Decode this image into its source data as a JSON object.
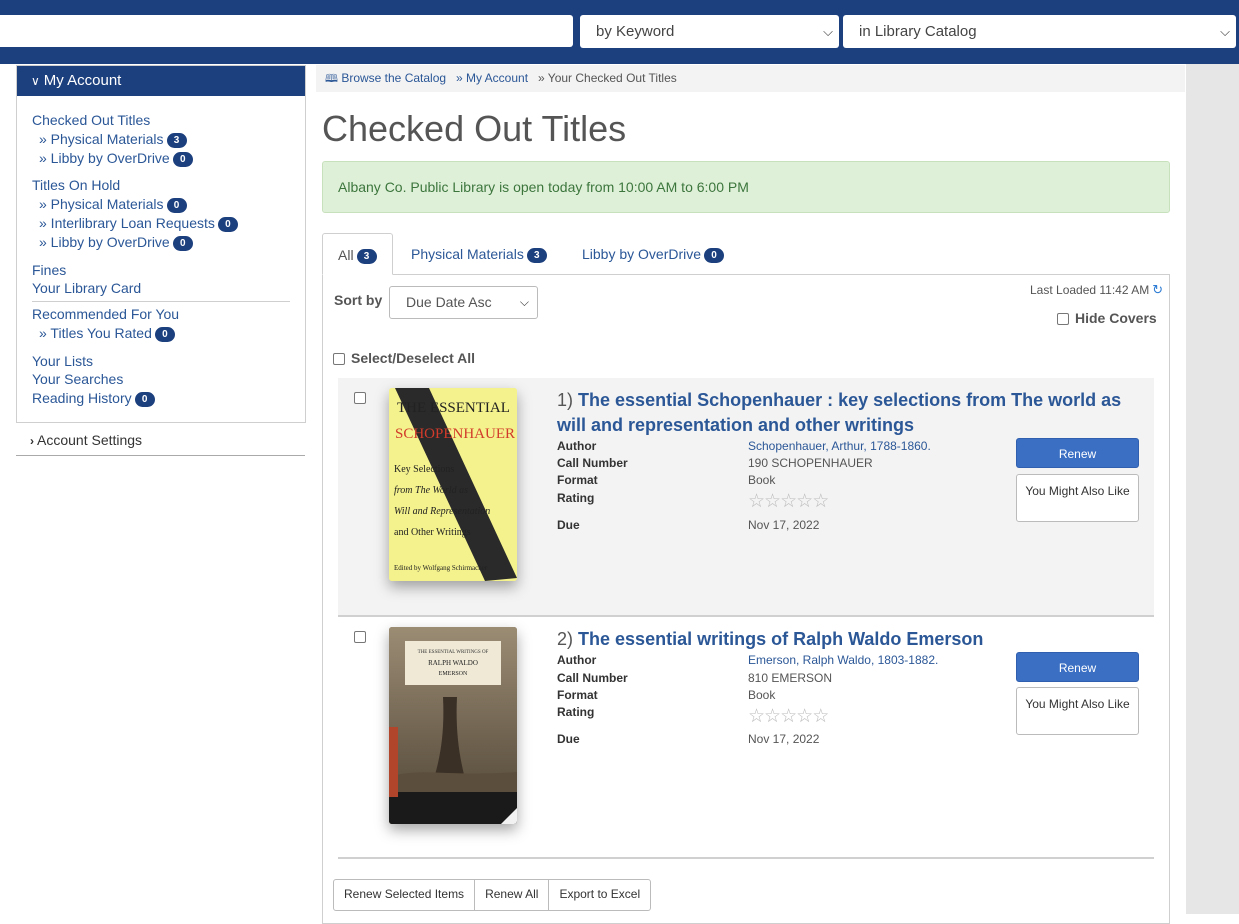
{
  "search": {
    "query": "",
    "search_by": "by Keyword",
    "search_in": "in Library Catalog"
  },
  "sidebar": {
    "header": "My Account",
    "sections": {
      "checked_out": "Checked Out Titles",
      "checked_physical": "» Physical Materials",
      "checked_physical_count": "3",
      "checked_libby": "» Libby by OverDrive",
      "checked_libby_count": "0",
      "on_hold": "Titles On Hold",
      "hold_physical": "» Physical Materials",
      "hold_physical_count": "0",
      "hold_ill": "» Interlibrary Loan Requests",
      "hold_ill_count": "0",
      "hold_libby": "» Libby by OverDrive",
      "hold_libby_count": "0",
      "fines": "Fines",
      "library_card": "Your Library Card",
      "recommended": "Recommended For You",
      "rated": "» Titles You Rated",
      "rated_count": "0",
      "lists": "Your Lists",
      "searches": "Your Searches",
      "history": "Reading History",
      "history_count": "0"
    },
    "account_settings": "Account Settings"
  },
  "breadcrumb": {
    "browse": "Browse the Catalog",
    "account": "» My Account",
    "current": "» Your Checked Out Titles"
  },
  "page_title": "Checked Out Titles",
  "alert": "Albany Co. Public Library is open today from 10:00 AM to 6:00 PM",
  "tabs": [
    {
      "label": "All",
      "count": "3"
    },
    {
      "label": "Physical Materials",
      "count": "3"
    },
    {
      "label": "Libby by OverDrive",
      "count": "0"
    }
  ],
  "controls": {
    "sort_label": "Sort by",
    "sort_value": "Due Date Asc",
    "last_loaded": "Last Loaded 11:42 AM",
    "hide_covers": "Hide Covers",
    "select_all": "Select/Deselect All"
  },
  "meta_labels": {
    "author": "Author",
    "call_number": "Call Number",
    "format": "Format",
    "rating": "Rating",
    "due": "Due"
  },
  "items": [
    {
      "num": "1)",
      "title": "The essential Schopenhauer : key selections from The world as will and representation and other writings",
      "author": "Schopenhauer, Arthur, 1788-1860.",
      "call_number": "190 SCHOPENHAUER",
      "format": "Book",
      "rating": 0,
      "due": "Nov 17, 2022",
      "cover_text": {
        "line1": "THE ESSENTIAL",
        "line2": "SCHOPENHAUER",
        "line3": "Key Selections",
        "line4": "from The World as",
        "line5": "Will and Representation",
        "line6": "and Other Writings",
        "line7": "Edited by Wolfgang Schirmacher"
      }
    },
    {
      "num": "2)",
      "title": "The essential writings of Ralph Waldo Emerson",
      "author": "Emerson, Ralph Waldo, 1803-1882.",
      "call_number": "810 EMERSON",
      "format": "Book",
      "rating": 0,
      "due": "Nov 17, 2022",
      "cover_text": {
        "line1": "THE ESSENTIAL WRITINGS OF",
        "line2": "RALPH WALDO",
        "line3": "EMERSON"
      }
    }
  ],
  "buttons": {
    "renew": "Renew",
    "you_might_like": "You Might Also Like",
    "renew_selected": "Renew Selected Items",
    "renew_all": "Renew All",
    "export": "Export to Excel"
  },
  "colors": {
    "brand": "#1c3f7e",
    "link": "#2b5797",
    "renew": "#3a6fc4",
    "alert_bg": "#dff0d8"
  }
}
